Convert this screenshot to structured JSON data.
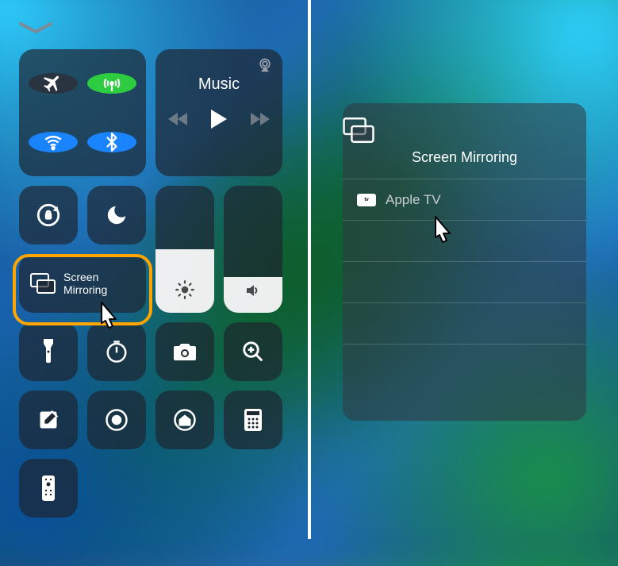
{
  "left": {
    "music": {
      "title": "Music"
    },
    "screen_mirroring": {
      "line1": "Screen",
      "line2": "Mirroring"
    },
    "brightness_pct": 50,
    "volume_pct": 28
  },
  "right": {
    "panel_title": "Screen Mirroring",
    "devices": [
      {
        "badge": "tv",
        "name": "Apple TV"
      }
    ]
  }
}
